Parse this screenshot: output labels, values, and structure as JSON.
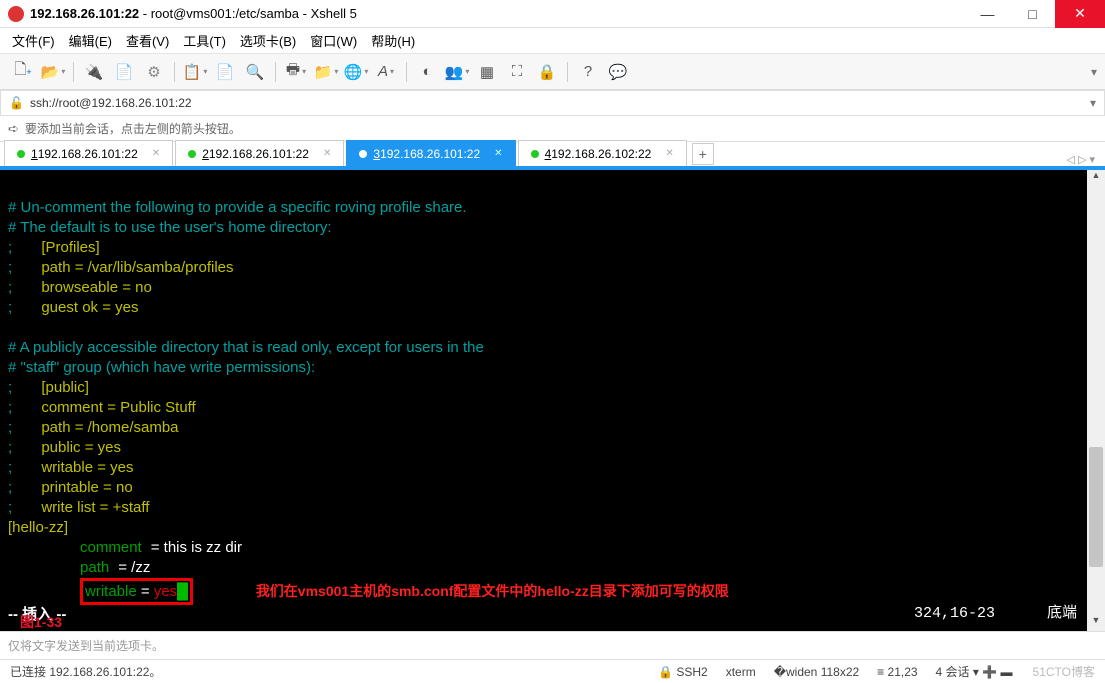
{
  "window": {
    "title_bold": "192.168.26.101:22",
    "title_rest": " - root@vms001:/etc/samba - Xshell 5"
  },
  "menu": [
    "文件(F)",
    "编辑(E)",
    "查看(V)",
    "工具(T)",
    "选项卡(B)",
    "窗口(W)",
    "帮助(H)"
  ],
  "address": "ssh://root@192.168.26.101:22",
  "hint": "要添加当前会话，点击左侧的箭头按钮。",
  "tabs": [
    {
      "num": "1",
      "label": " 192.168.26.101:22",
      "active": false
    },
    {
      "num": "2",
      "label": " 192.168.26.101:22",
      "active": false
    },
    {
      "num": "3",
      "label": " 192.168.26.101:22",
      "active": true
    },
    {
      "num": "4",
      "label": " 192.168.26.102:22",
      "active": false
    }
  ],
  "terminal": {
    "lines": [
      {
        "t": "",
        "c": ""
      },
      {
        "t": "# Un-comment the following to provide a specific roving profile share.",
        "c": "cyan"
      },
      {
        "t": "# The default is to use the user's home directory:",
        "c": "cyan"
      },
      {
        "pre": ";       ",
        "k": "[Profiles]"
      },
      {
        "pre": ";       ",
        "k": "path = /var/lib/samba/profiles"
      },
      {
        "pre": ";       ",
        "k": "browseable = no"
      },
      {
        "pre": ";       ",
        "k": "guest ok = yes"
      },
      {
        "t": "",
        "c": ""
      },
      {
        "t": "# A publicly accessible directory that is read only, except for users in the",
        "c": "cyan"
      },
      {
        "t": "# \"staff\" group (which have write permissions):",
        "c": "cyan"
      },
      {
        "pre": ";       ",
        "k": "[public]"
      },
      {
        "pre": ";       ",
        "k": "comment = Public Stuff"
      },
      {
        "pre": ";       ",
        "k": "path = /home/samba"
      },
      {
        "pre": ";       ",
        "k": "public = yes"
      },
      {
        "pre": ";       ",
        "k": "writable = yes"
      },
      {
        "pre": ";       ",
        "k": "printable = no"
      },
      {
        "pre": ";       ",
        "k": "write list = +staff"
      }
    ],
    "section": "[hello-zz]",
    "cfg": [
      {
        "k": "comment",
        "v": "= this is zz dir"
      },
      {
        "k": "path",
        "v": "= /zz"
      }
    ],
    "boxed": {
      "k": "writable",
      "eq": " = ",
      "v": "yes"
    },
    "annotation": "我们在vms001主机的smb.conf配置文件中的hello-zz目录下添加可写的权限",
    "mode": "-- 插入 --",
    "ruler": "324,16-23",
    "botright": "底端",
    "figure_label": "图1-33"
  },
  "lowerhint": "仅将文字发送到当前选项卡。",
  "status": {
    "left": "已连接 192.168.26.101:22。",
    "ssh": "SSH2",
    "term": "xterm",
    "size": "118x22",
    "pos": "21,23",
    "sess": "4 会话",
    "watermark": "51CTO博客"
  }
}
